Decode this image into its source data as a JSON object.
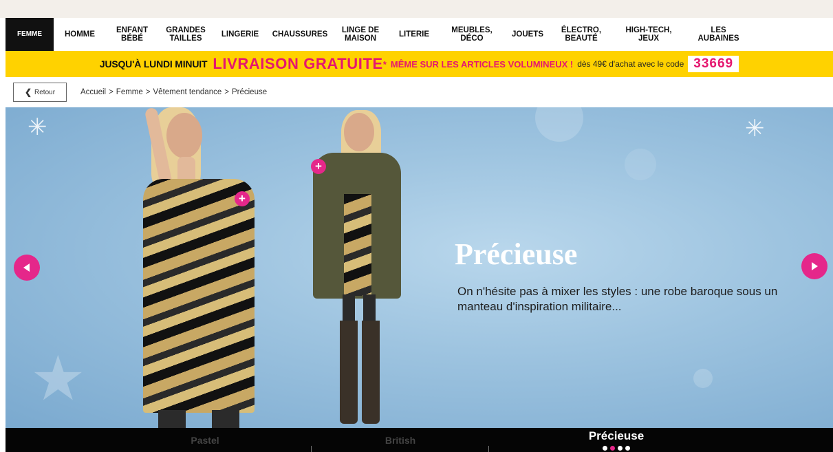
{
  "nav": {
    "items": [
      {
        "label": "FEMME",
        "active": true
      },
      {
        "label": "HOMME"
      },
      {
        "label": "ENFANT\nBÉBÉ"
      },
      {
        "label": "GRANDES\nTAILLES"
      },
      {
        "label": "LINGERIE"
      },
      {
        "label": "CHAUSSURES"
      },
      {
        "label": "LINGE DE\nMAISON"
      },
      {
        "label": "LITERIE"
      },
      {
        "label": "MEUBLES,\nDÉCO"
      },
      {
        "label": "JOUETS"
      },
      {
        "label": "ÉLECTRO,\nBEAUTÉ"
      },
      {
        "label": "HIGH-TECH,\nJEUX"
      },
      {
        "label": "LES\nAUBAINES"
      }
    ]
  },
  "promo": {
    "deadline": "JUSQU'À LUNDI MINUIT",
    "headline": "LIVRAISON GRATUITE",
    "asterisk": "*",
    "subline": "MÊME SUR LES ARTICLES VOLUMINEUX !",
    "condition": "dès 49€ d'achat avec le code",
    "code": "33669",
    "colors": {
      "background": "#ffd200",
      "accent": "#e5176f"
    }
  },
  "breadcrumb": {
    "back_label": "Retour",
    "back_icon": "chevron-left-icon",
    "items": [
      "Accueil",
      "Femme",
      "Vêtement tendance",
      "Précieuse"
    ],
    "separator": ">"
  },
  "hero": {
    "title": "Précieuse",
    "description": "On n'hésite pas à mixer les styles : une robe baroque sous un manteau d'inspiration militaire...",
    "prev_icon": "arrow-left-icon",
    "next_icon": "arrow-right-icon",
    "hotspot_label": "+",
    "accent_color": "#e5278a"
  },
  "carousel_tabs": {
    "items": [
      {
        "label": "Pastel"
      },
      {
        "label": "British"
      },
      {
        "label": "Précieuse",
        "active": true
      }
    ],
    "dots": [
      false,
      true,
      false,
      false
    ]
  }
}
